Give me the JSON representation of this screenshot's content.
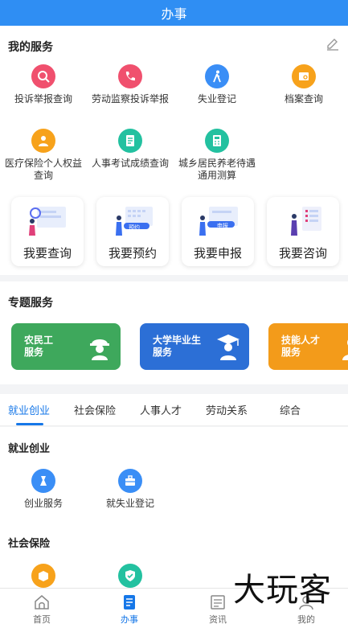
{
  "header": {
    "title": "办事"
  },
  "my_services": {
    "title": "我的服务",
    "items": [
      {
        "label": "投诉举报查询",
        "icon": "complaint-search-icon",
        "color": "#f0506e"
      },
      {
        "label": "劳动监察投诉举报",
        "icon": "phone-icon",
        "color": "#f0506e"
      },
      {
        "label": "失业登记",
        "icon": "walking-person-icon",
        "color": "#3a8ef6"
      },
      {
        "label": "档案查询",
        "icon": "file-icon",
        "color": "#f7a21b"
      },
      {
        "label": "医疗保险个人权益查询",
        "icon": "medical-person-icon",
        "color": "#f7a21b"
      },
      {
        "label": "人事考试成绩查询",
        "icon": "exam-doc-icon",
        "color": "#23c1a0"
      },
      {
        "label": "城乡居民养老待遇通用测算",
        "icon": "calculator-icon",
        "color": "#23c1a0"
      }
    ]
  },
  "quick_cards": [
    {
      "label": "我要查询"
    },
    {
      "label": "我要预约",
      "badge": "预约"
    },
    {
      "label": "我要申报",
      "badge": "申报"
    },
    {
      "label": "我要咨询"
    }
  ],
  "topic_services": {
    "title": "专题服务",
    "banners": [
      {
        "line1": "农民工",
        "line2": "服务",
        "color": "#3ea85c"
      },
      {
        "line1": "大学毕业生",
        "line2": "服务",
        "color": "#2c6fd6"
      },
      {
        "line1": "技能人才",
        "line2": "服务",
        "color": "#f39b1a"
      }
    ]
  },
  "tabs": [
    {
      "label": "就业创业",
      "active": true
    },
    {
      "label": "社会保险",
      "active": false
    },
    {
      "label": "人事人才",
      "active": false
    },
    {
      "label": "劳动关系",
      "active": false
    },
    {
      "label": "综合",
      "active": false
    }
  ],
  "employment": {
    "title": "就业创业",
    "items": [
      {
        "label": "创业服务",
        "icon": "startup-icon",
        "color": "#3a8ef6"
      },
      {
        "label": "就失业登记",
        "icon": "briefcase-icon",
        "color": "#3a8ef6"
      }
    ]
  },
  "social_insurance": {
    "title": "社会保险",
    "items": [
      {
        "icon": "box-icon",
        "color": "#f7a21b"
      },
      {
        "icon": "shield-icon",
        "color": "#23c1a0"
      }
    ]
  },
  "bottom_nav": [
    {
      "label": "首页",
      "icon": "home-icon",
      "active": false
    },
    {
      "label": "办事",
      "icon": "task-icon",
      "active": true
    },
    {
      "label": "资讯",
      "icon": "news-icon",
      "active": false
    },
    {
      "label": "我的",
      "icon": "user-icon",
      "active": false
    }
  ],
  "watermark": "大玩客"
}
